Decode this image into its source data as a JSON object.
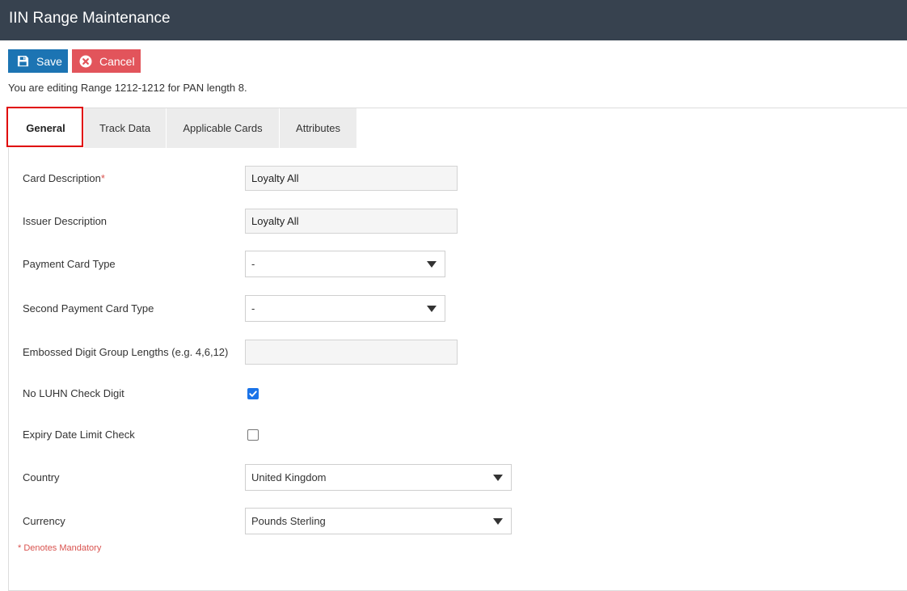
{
  "header": {
    "title": "IIN Range Maintenance"
  },
  "toolbar": {
    "save_label": "Save",
    "cancel_label": "Cancel"
  },
  "editing_message": "You are editing Range 1212-1212 for PAN length 8.",
  "tabs": [
    {
      "label": "General",
      "active": true
    },
    {
      "label": "Track Data",
      "active": false
    },
    {
      "label": "Applicable Cards",
      "active": false
    },
    {
      "label": "Attributes",
      "active": false
    }
  ],
  "form": {
    "card_description": {
      "label": "Card Description",
      "required_marker": "*",
      "value": "Loyalty All"
    },
    "issuer_description": {
      "label": "Issuer Description",
      "value": "Loyalty All"
    },
    "payment_card_type": {
      "label": "Payment Card Type",
      "value": "-"
    },
    "second_payment_card_type": {
      "label": "Second Payment Card Type",
      "value": "-"
    },
    "embossed_digit_group_lengths": {
      "label": "Embossed Digit Group Lengths (e.g. 4,6,12)",
      "value": ""
    },
    "no_luhn_check_digit": {
      "label": "No LUHN Check Digit",
      "checked": true
    },
    "expiry_date_limit_check": {
      "label": "Expiry Date Limit Check",
      "checked": false
    },
    "country": {
      "label": "Country",
      "value": "United Kingdom"
    },
    "currency": {
      "label": "Currency",
      "value": "Pounds Sterling"
    }
  },
  "mandatory_note": "* Denotes Mandatory",
  "icons": {
    "save": "floppy-disk-icon",
    "cancel": "circle-x-icon",
    "dropdown": "caret-down-icon",
    "checkmark": "checkmark-icon"
  },
  "colors": {
    "header_bg": "#37424f",
    "save_button": "#1c74b3",
    "cancel_button": "#e2545b",
    "active_tab_outline": "#e00000",
    "required_marker": "#d9534f",
    "checkbox_checked": "#1a73e8"
  }
}
